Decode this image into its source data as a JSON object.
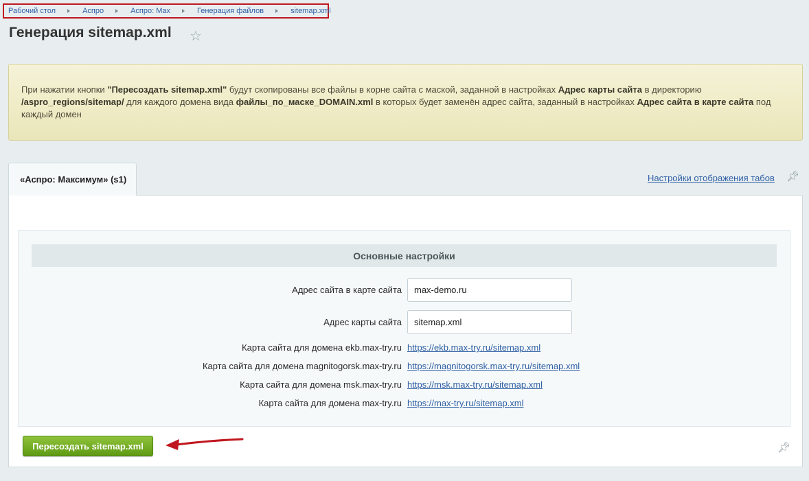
{
  "breadcrumb": {
    "items": [
      "Рабочий стол",
      "Аспро",
      "Аспро: Max",
      "Генерация файлов",
      "sitemap.xml"
    ]
  },
  "page": {
    "title": "Генерация sitemap.xml"
  },
  "info": {
    "p1": "При нажатии кнопки ",
    "b1": "\"Пересоздать sitemap.xml\"",
    "p2": " будут скопированы все файлы в корне сайта с маской, заданной в настройках ",
    "b2": "Адрес карты сайта",
    "p3": " в директорию ",
    "b3": "/aspro_regions/sitemap/",
    "p4": " для каждого домена вида ",
    "b4": "файлы_по_маске_DOMAIN.xml",
    "p5": " в которых будет заменён адрес сайта, заданный в настройках ",
    "b5": "Адрес сайта в карте сайта",
    "p6": " под каждый домен"
  },
  "tabs": {
    "active_label": "«Аспро: Максимум» (s1)",
    "settings_link": "Настройки отображения табов"
  },
  "section": {
    "header": "Основные настройки",
    "site_address_label": "Адрес сайта в карте сайта",
    "site_address_value": "max-demo.ru",
    "sitemap_address_label": "Адрес карты сайта",
    "sitemap_address_value": "sitemap.xml",
    "links": [
      {
        "label": "Карта сайта для домена ekb.max-try.ru",
        "url": "https://ekb.max-try.ru/sitemap.xml"
      },
      {
        "label": "Карта сайта для домена magnitogorsk.max-try.ru",
        "url": "https://magnitogorsk.max-try.ru/sitemap.xml"
      },
      {
        "label": "Карта сайта для домена msk.max-try.ru",
        "url": "https://msk.max-try.ru/sitemap.xml"
      },
      {
        "label": "Карта сайта для домена max-try.ru",
        "url": "https://max-try.ru/sitemap.xml"
      }
    ]
  },
  "actions": {
    "regenerate_label": "Пересоздать sitemap.xml"
  },
  "colors": {
    "accent_green": "#6aa61f",
    "link_blue": "#2f5fa5",
    "annotation_red": "#c0171f"
  }
}
